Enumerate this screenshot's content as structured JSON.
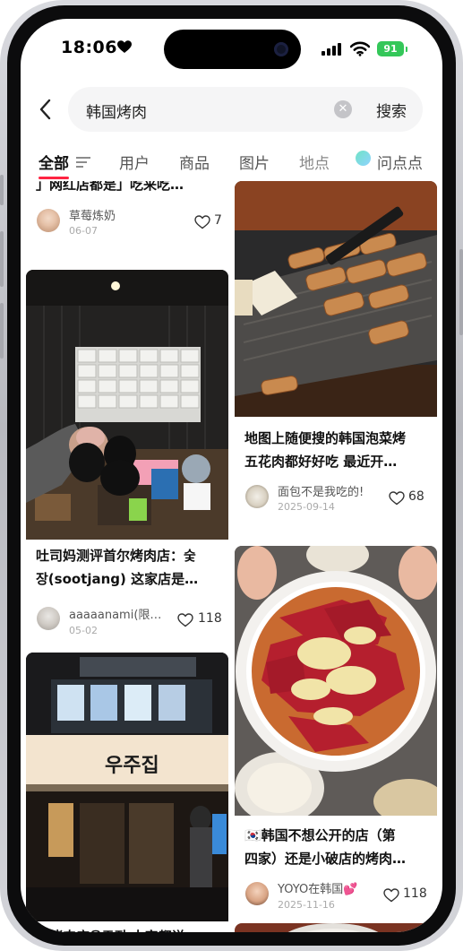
{
  "status": {
    "time": "18:06",
    "battery": "91"
  },
  "search": {
    "query": "韩国烤肉",
    "button": "搜索"
  },
  "tabs": [
    {
      "label": "全部"
    },
    {
      "label": "用户"
    },
    {
      "label": "商品"
    },
    {
      "label": "图片"
    },
    {
      "label": "地点"
    },
    {
      "label": "问点点"
    }
  ],
  "posts": [
    {
      "title": "」网红店都是」吃来吃…",
      "author": "草莓炼奶",
      "date": "06-07",
      "likes": "7"
    },
    {
      "title_line1": "吐司妈测评首尔烤肉店：숯",
      "title_line2": "장(sootjang) 这家店是…",
      "author": "aaaaanami(限…",
      "date": "05-02",
      "likes": "118"
    },
    {
      "title_line1": "大烤肉店우주집 大家都说"
    },
    {
      "title_line1": "地图上随便搜的韩国泡菜烤",
      "title_line2": "五花肉都好好吃 最近开…",
      "author": "面包不是我吃的!",
      "date": "2025-09-14",
      "likes": "68"
    },
    {
      "title_line1": "🇰🇷韩国不想公开的店（第",
      "title_line2": "四家）还是小破店的烤肉…",
      "author": "YOYO在韩国💕",
      "date": "2025-11-16",
      "likes": "118"
    }
  ],
  "storefront": {
    "sign": "우주집"
  }
}
